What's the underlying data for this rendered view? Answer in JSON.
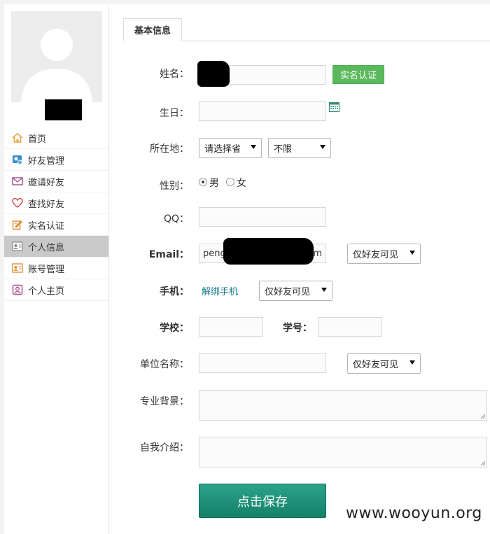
{
  "sidebar": {
    "menu": [
      {
        "label": "首页",
        "icon": "home-icon"
      },
      {
        "label": "好友管理",
        "icon": "friends-manage-icon"
      },
      {
        "label": "邀请好友",
        "icon": "envelope-icon"
      },
      {
        "label": "查找好友",
        "icon": "heart-icon"
      },
      {
        "label": "实名认证",
        "icon": "edit-icon"
      },
      {
        "label": "个人信息",
        "icon": "profile-card-icon",
        "active": true
      },
      {
        "label": "账号管理",
        "icon": "account-card-icon"
      },
      {
        "label": "个人主页",
        "icon": "user-icon"
      }
    ]
  },
  "tabs": {
    "basic": "基本信息"
  },
  "form": {
    "name_label": "姓名：",
    "verify_btn": "实名认证",
    "birthday_label": "生日：",
    "location_label": "所在地：",
    "province_value": "请选择省",
    "city_value": "不限",
    "gender_label": "性别：",
    "gender_male": "男",
    "gender_female": "女",
    "qq_label": "QQ：",
    "email_label": "Email：",
    "email_value_start": "peng",
    "email_value_end": "com",
    "email_visibility": "仅好友可见",
    "phone_label": "手机：",
    "unbind_phone": "解绑手机",
    "phone_visibility": "仅好友可见",
    "school_label": "学校：",
    "student_id_label": "学号：",
    "company_label": "单位名称：",
    "company_visibility": "仅好友可见",
    "background_label": "专业背景：",
    "intro_label": "自我介绍：",
    "save_btn": "点击保存"
  },
  "watermark": "www.wooyun.org",
  "colors": {
    "verify_green": "#5cb85c",
    "save_teal": "#1a9478",
    "active_menu_bg": "#c9c9c9"
  }
}
